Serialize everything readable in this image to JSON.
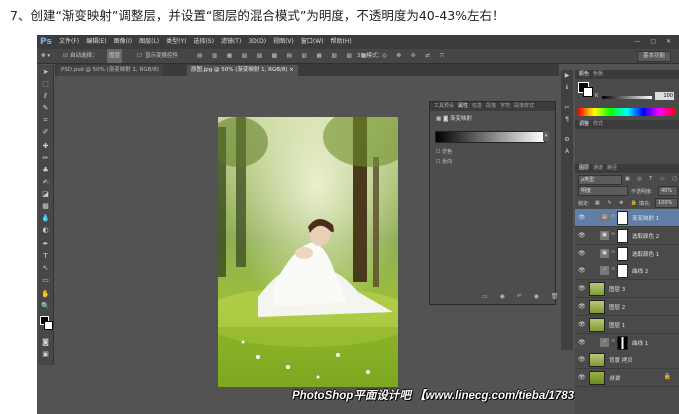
{
  "instruction": "7、创建“渐变映射”调整层，并设置“图层的混合模式”为明度，不透明度为40-43%左右！",
  "app": {
    "logo": "Ps",
    "menus": [
      "文件(F)",
      "编辑(E)",
      "图像(I)",
      "图层(L)",
      "类型(Y)",
      "选择(S)",
      "滤镜(T)",
      "3D(D)",
      "视图(V)",
      "窗口(W)",
      "帮助(H)"
    ],
    "window_buttons": "— ▢ ✕"
  },
  "options_bar": {
    "auto_select": "自动选择：",
    "auto_select_value": "图层",
    "show_transform": "显示变换控件",
    "mode_3d": "3D 模式：",
    "workspace": "基本功能"
  },
  "doc_tabs": [
    {
      "label": "PSD.psd @ 50% (渐变映射 1, RGB/8)",
      "active": false
    },
    {
      "label": "原图.jpg @ 50% (渐变映射 1, RGB/8) ×",
      "active": true
    }
  ],
  "properties": {
    "tabs": [
      "工具预设",
      "属性",
      "信息",
      "段落",
      "字符",
      "段落样式"
    ],
    "active_tab": "属性",
    "title": "渐变映射",
    "dither": "仿色",
    "reverse": "反向",
    "footer_icons": "▭ ◉ ↶ ◉ 🗑"
  },
  "watermark": "PhotoShop平面设计吧 【www.linecg.com/tieba/1783】",
  "color_panel": {
    "tabs": [
      "颜色",
      "色板"
    ],
    "k_label": "K",
    "k_value": "100"
  },
  "adjust_tabs": [
    "调整",
    "样式"
  ],
  "layers_panel": {
    "tabs": [
      "图层",
      "通道",
      "路径"
    ],
    "kind_filter": "ρ类型",
    "blend_mode": "明度",
    "opacity_label": "不透明度:",
    "opacity_value": "40%",
    "lock_label": "锁定:",
    "fill_label": "填充:",
    "fill_value": "100%",
    "layers": [
      {
        "name": "渐变映射 1",
        "type": "adjust",
        "icon": "▤",
        "selected": true
      },
      {
        "name": "选取颜色 2",
        "type": "adjust",
        "icon": "▣",
        "selected": false
      },
      {
        "name": "选取颜色 1",
        "type": "adjust",
        "icon": "▣",
        "selected": false
      },
      {
        "name": "曲线 2",
        "type": "adjust",
        "icon": "⟋",
        "selected": false
      },
      {
        "name": "图层 3",
        "type": "image",
        "selected": false
      },
      {
        "name": "图层 2",
        "type": "image",
        "selected": false
      },
      {
        "name": "图层 1",
        "type": "image",
        "selected": false
      },
      {
        "name": "曲线 1",
        "type": "adjust-black",
        "icon": "⟋",
        "selected": false
      },
      {
        "name": "背景 拷贝",
        "type": "image",
        "selected": false
      },
      {
        "name": "背景",
        "type": "background",
        "selected": false,
        "locked": true
      }
    ]
  }
}
